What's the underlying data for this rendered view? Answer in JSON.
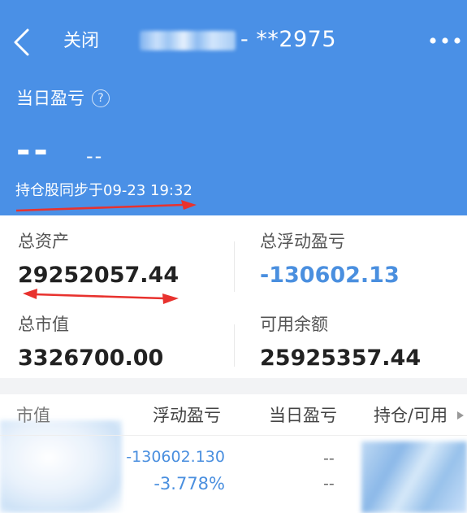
{
  "header": {
    "back_icon": "back-arrow-icon",
    "close_label": "关闭",
    "account_title": "- **2975",
    "more_icon": "more-dots-icon",
    "daily_pnl_label": "当日盈亏",
    "help_icon": "question-circle-icon",
    "daily_pnl_value": "--",
    "daily_pnl_pct": "--",
    "sync_text": "持仓股同步于09-23 19:32"
  },
  "summary": {
    "total_assets_label": "总资产",
    "total_assets_value": "29252057.44",
    "total_float_pnl_label": "总浮动盈亏",
    "total_float_pnl_value": "-130602.13",
    "total_market_value_label": "总市值",
    "total_market_value_value": "3326700.00",
    "available_balance_label": "可用余额",
    "available_balance_value": "25925357.44"
  },
  "holdings": {
    "columns": [
      "市值",
      "浮动盈亏",
      "当日盈亏",
      "持仓/可用"
    ],
    "column_arrow_icon": "triangle-right-icon",
    "rows": [
      {
        "float_pnl": "-130602.130",
        "float_pnl_pct": "-3.778%",
        "daily_pnl": "--",
        "daily_pnl_pct": "--"
      }
    ]
  },
  "colors": {
    "header_bg": "#4a90e6",
    "negative_blue": "#4a8fdf",
    "annotation_red": "#e8322e"
  }
}
